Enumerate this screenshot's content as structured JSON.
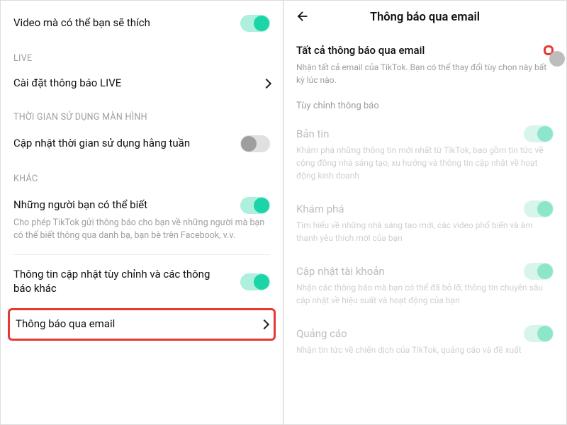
{
  "left": {
    "videoSuggest": "Video mà có thể bạn sẽ thích",
    "sections": {
      "live": "LIVE",
      "liveSetting": "Cài đặt thông báo LIVE",
      "screenTime": "THỜI GIAN SỬ DỤNG MÀN HÌNH",
      "weeklyUpdate": "Cập nhật thời gian sử dụng hằng tuần",
      "other": "KHÁC",
      "peopleKnow": "Những người bạn có thể biết",
      "peopleKnowSub": "Cho phép TikTok gửi thông báo cho bạn về những người mà bạn có thể biết thông qua danh bạ, bạn bè trên Facebook, v.v.",
      "customUpdates": "Thông tin cập nhật tùy chỉnh và các thông báo khác",
      "emailNotif": "Thông báo qua email"
    }
  },
  "right": {
    "header": "Thông báo qua email",
    "allEmail": "Tất cả thông báo qua email",
    "allEmailSub": "Nhận tất cả email của TikTok. Bạn có thể thay đổi tùy chọn này bất kỳ lúc nào.",
    "customize": "Tùy chỉnh thông báo",
    "items": [
      {
        "title": "Bản tin",
        "sub": "Khám phá những thông tin mới nhất từ TikTok, bao gồm tin tức về cộng đồng nhà sáng tạo, xu hướng và thông tin cập nhật về hoạt động kinh doanh"
      },
      {
        "title": "Khám phá",
        "sub": "Tìm hiểu về những nhà sáng tạo mới, các video phổ biến và âm thanh yêu thích mới của bạn"
      },
      {
        "title": "Cập nhật tài khoản",
        "sub": "Nhận các thông báo mà bạn có thể đã bỏ lỡ, thông tin chuyên sâu cập nhật về hiệu suất và hoạt động của bạn"
      },
      {
        "title": "Quảng cáo",
        "sub": "Nhận tin tức về chiến dịch của TikTok, quảng cáo và đề xuất"
      }
    ]
  }
}
